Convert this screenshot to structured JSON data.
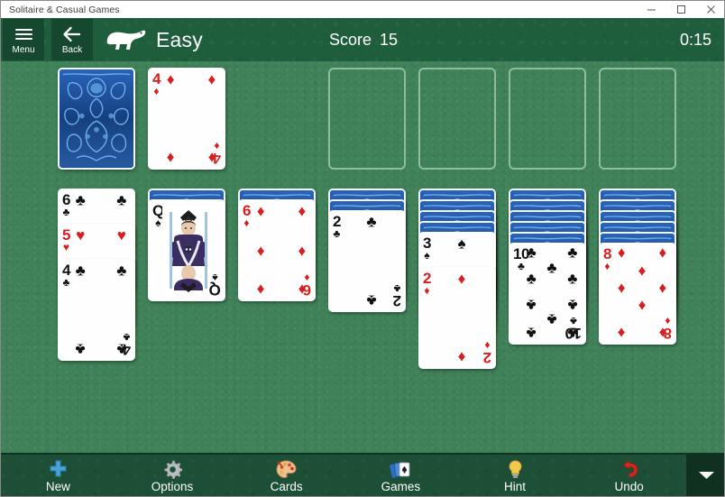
{
  "window": {
    "title": "Solitaire & Casual Games",
    "controls": [
      {
        "name": "minimize-button",
        "glyph": "minimize"
      },
      {
        "name": "maximize-button",
        "glyph": "maximize"
      },
      {
        "name": "close-button",
        "glyph": "close"
      }
    ]
  },
  "header": {
    "menu_label": "Menu",
    "back_label": "Back",
    "logo": "polar-bear-logo",
    "difficulty": "Easy",
    "score_label": "Score",
    "score_value": "15",
    "timer": "0:15",
    "background_color": "#1f5e3d"
  },
  "board": {
    "felt_color": "#3f8159",
    "stock": {
      "name": "stock-pile",
      "face_down_count": 1
    },
    "waste": {
      "name": "waste-pile",
      "card": {
        "rank": "4",
        "suit": "diamonds",
        "color": "red"
      }
    },
    "foundations": [
      {
        "name": "foundation-slot-1",
        "empty": true
      },
      {
        "name": "foundation-slot-2",
        "empty": true
      },
      {
        "name": "foundation-slot-3",
        "empty": true
      },
      {
        "name": "foundation-slot-4",
        "empty": true
      }
    ],
    "tableau": [
      {
        "name": "tableau-column-1",
        "face_down": 0,
        "face_up": [
          {
            "rank": "6",
            "suit": "clubs",
            "color": "black"
          },
          {
            "rank": "5",
            "suit": "hearts",
            "color": "red"
          },
          {
            "rank": "4",
            "suit": "clubs",
            "color": "black"
          }
        ]
      },
      {
        "name": "tableau-column-2",
        "face_down": 1,
        "face_up": [
          {
            "rank": "Q",
            "suit": "spades",
            "color": "black"
          }
        ]
      },
      {
        "name": "tableau-column-3",
        "face_down": 1,
        "face_up": [
          {
            "rank": "6",
            "suit": "diamonds",
            "color": "red"
          }
        ]
      },
      {
        "name": "tableau-column-4",
        "face_down": 2,
        "face_up": [
          {
            "rank": "2",
            "suit": "clubs",
            "color": "black"
          }
        ]
      },
      {
        "name": "tableau-column-5",
        "face_down": 4,
        "face_up": [
          {
            "rank": "3",
            "suit": "spades",
            "color": "black"
          },
          {
            "rank": "2",
            "suit": "diamonds",
            "color": "red"
          }
        ]
      },
      {
        "name": "tableau-column-6",
        "face_down": 5,
        "face_up": [
          {
            "rank": "10",
            "suit": "clubs",
            "color": "black"
          }
        ]
      },
      {
        "name": "tableau-column-7",
        "face_down": 5,
        "face_up": [
          {
            "rank": "8",
            "suit": "diamonds",
            "color": "red"
          }
        ]
      }
    ]
  },
  "toolbar": {
    "items": [
      {
        "name": "new-button",
        "label": "New",
        "icon": "plus-icon",
        "color": "#4aa3d8"
      },
      {
        "name": "options-button",
        "label": "Options",
        "icon": "gear-icon",
        "color": "#b9bcbe"
      },
      {
        "name": "cards-button",
        "label": "Cards",
        "icon": "palette-icon",
        "color": "#e8a33d"
      },
      {
        "name": "games-button",
        "label": "Games",
        "icon": "card-fan-icon",
        "color": "#2f6fc0"
      },
      {
        "name": "hint-button",
        "label": "Hint",
        "icon": "lightbulb-icon",
        "color": "#f2c94c"
      },
      {
        "name": "undo-button",
        "label": "Undo",
        "icon": "undo-arrow-icon",
        "color": "#cc2b1f"
      }
    ],
    "more": {
      "name": "more-button",
      "icon": "chevron-down-icon"
    }
  }
}
